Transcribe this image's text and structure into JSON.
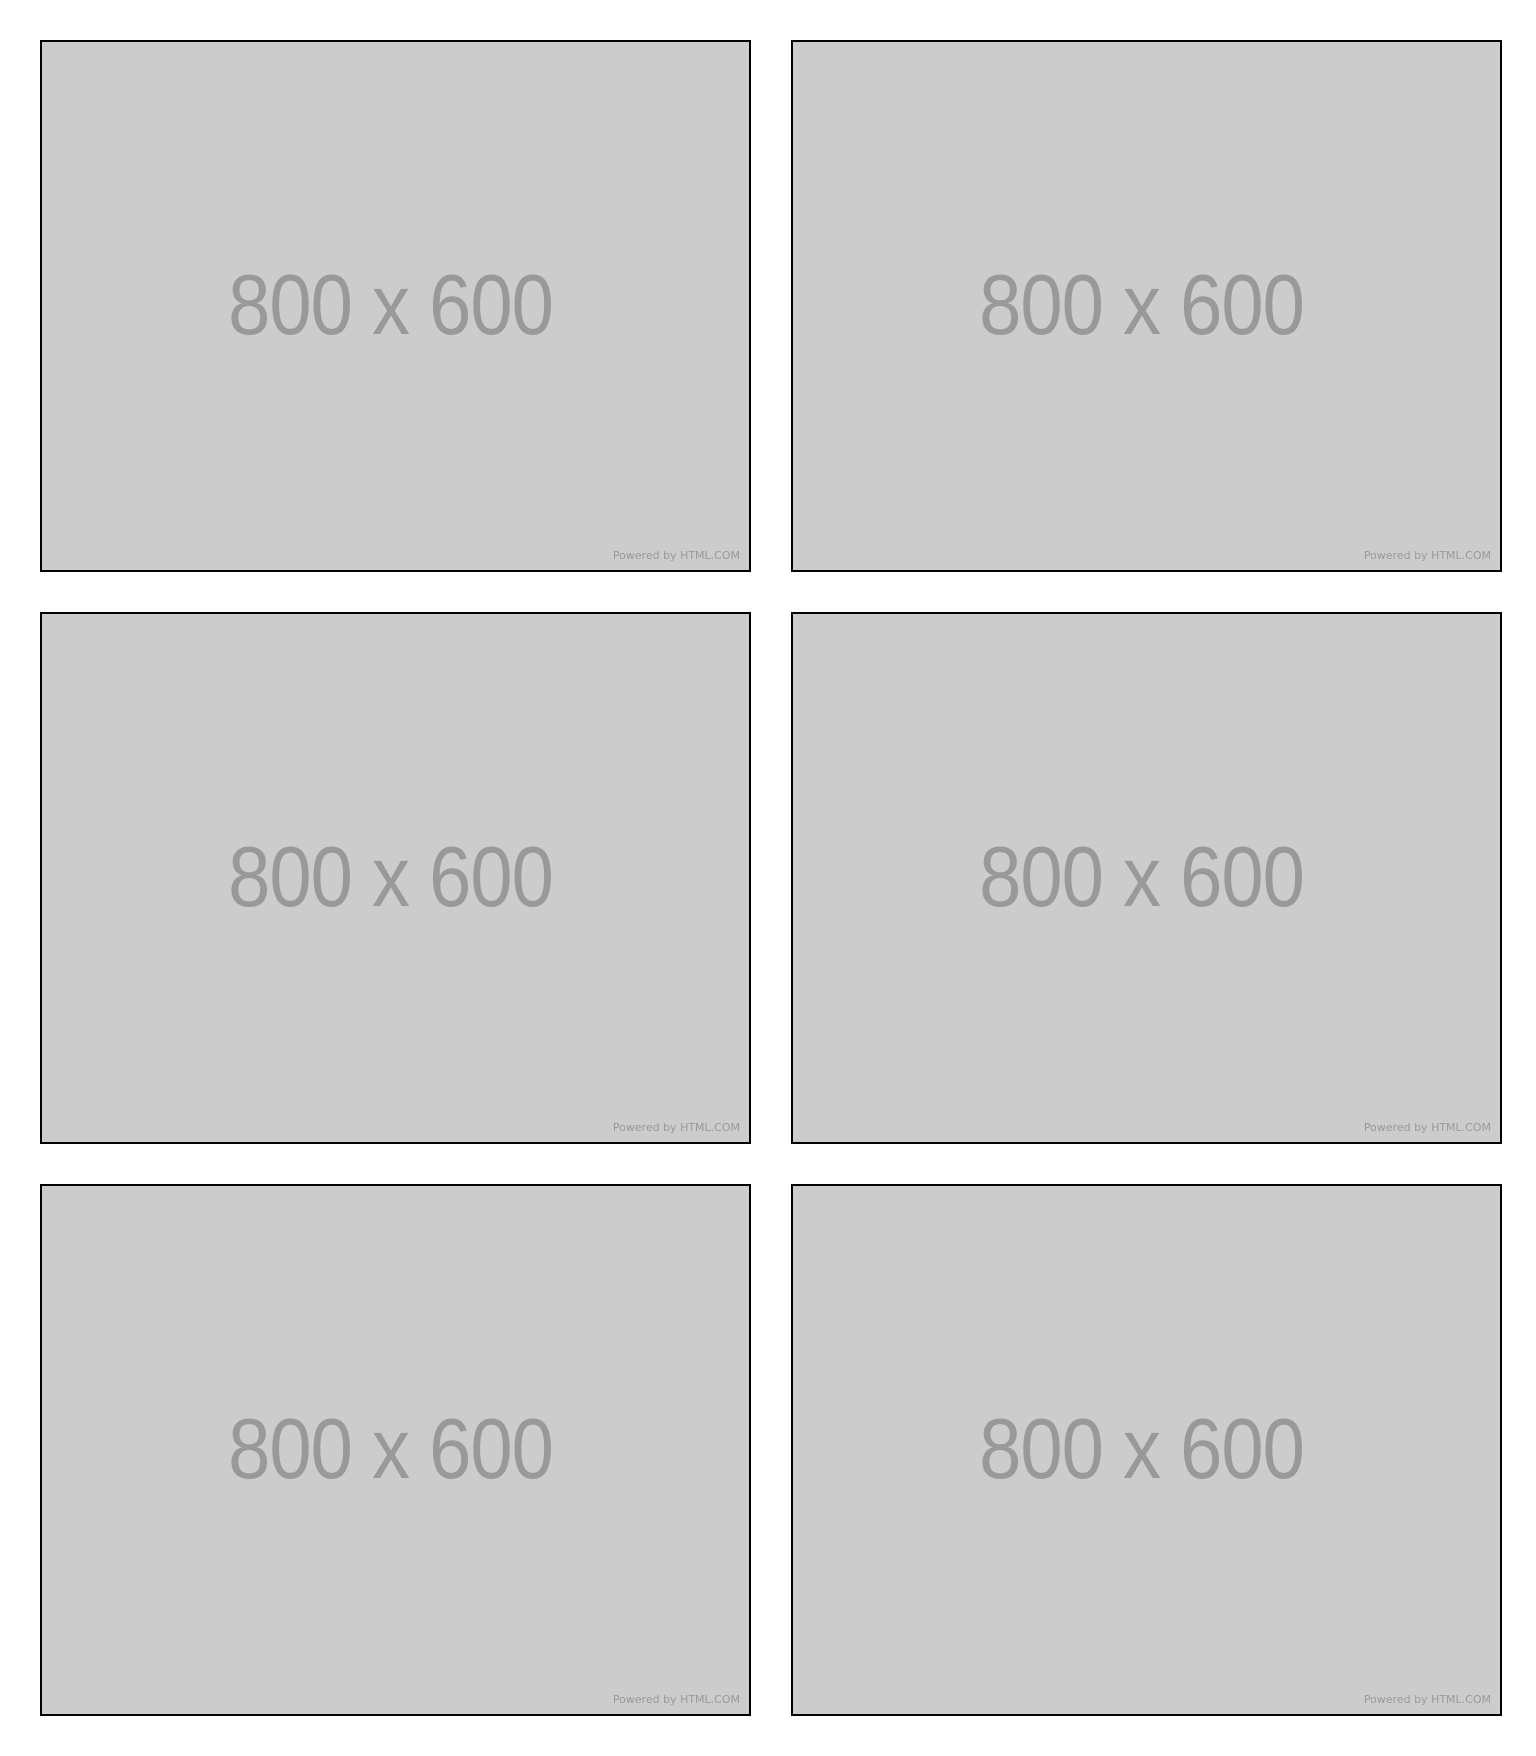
{
  "placeholders": [
    {
      "label": "800 x 600",
      "credit": "Powered by HTML.COM"
    },
    {
      "label": "800 x 600",
      "credit": "Powered by HTML.COM"
    },
    {
      "label": "800 x 600",
      "credit": "Powered by HTML.COM"
    },
    {
      "label": "800 x 600",
      "credit": "Powered by HTML.COM"
    },
    {
      "label": "800 x 600",
      "credit": "Powered by HTML.COM"
    },
    {
      "label": "800 x 600",
      "credit": "Powered by HTML.COM"
    }
  ],
  "colors": {
    "tile_background": "#cccccc",
    "tile_border": "#000000",
    "tile_text": "#999999",
    "page_background": "#ffffff"
  }
}
